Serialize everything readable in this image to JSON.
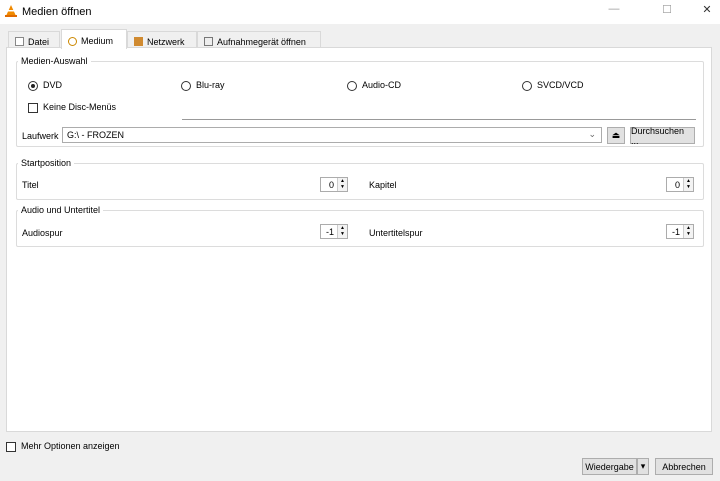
{
  "window": {
    "title": "Medien öffnen",
    "minimize": "—",
    "maximize": "☐",
    "close": "✕"
  },
  "tabs": [
    {
      "label": "Datei"
    },
    {
      "label": "Medium"
    },
    {
      "label": "Netzwerk"
    },
    {
      "label": "Aufnahmegerät öffnen"
    }
  ],
  "media_selection": {
    "title": "Medien-Auswahl",
    "options": [
      {
        "label": "DVD",
        "selected": true
      },
      {
        "label": "Blu-ray",
        "selected": false
      },
      {
        "label": "Audio-CD",
        "selected": false
      },
      {
        "label": "SVCD/VCD",
        "selected": false
      }
    ],
    "no_menus_label": "Keine Disc-Menüs",
    "no_menus_checked": false,
    "drive_label": "Laufwerk",
    "drive_value": "G:\\ - FROZEN",
    "eject": "⏏",
    "browse_label": "Durchsuchen ..."
  },
  "start_position": {
    "title": "Startposition",
    "title_label": "Titel",
    "title_value": "0",
    "chapter_label": "Kapitel",
    "chapter_value": "0"
  },
  "audio_subs": {
    "title": "Audio und Untertitel",
    "audio_label": "Audiospur",
    "audio_value": "-1",
    "subs_label": "Untertitelspur",
    "subs_value": "-1"
  },
  "footer": {
    "more_options_label": "Mehr Optionen anzeigen",
    "play_label": "Wiedergabe",
    "play_arrow": "▾",
    "cancel_label": "Abbrechen"
  }
}
